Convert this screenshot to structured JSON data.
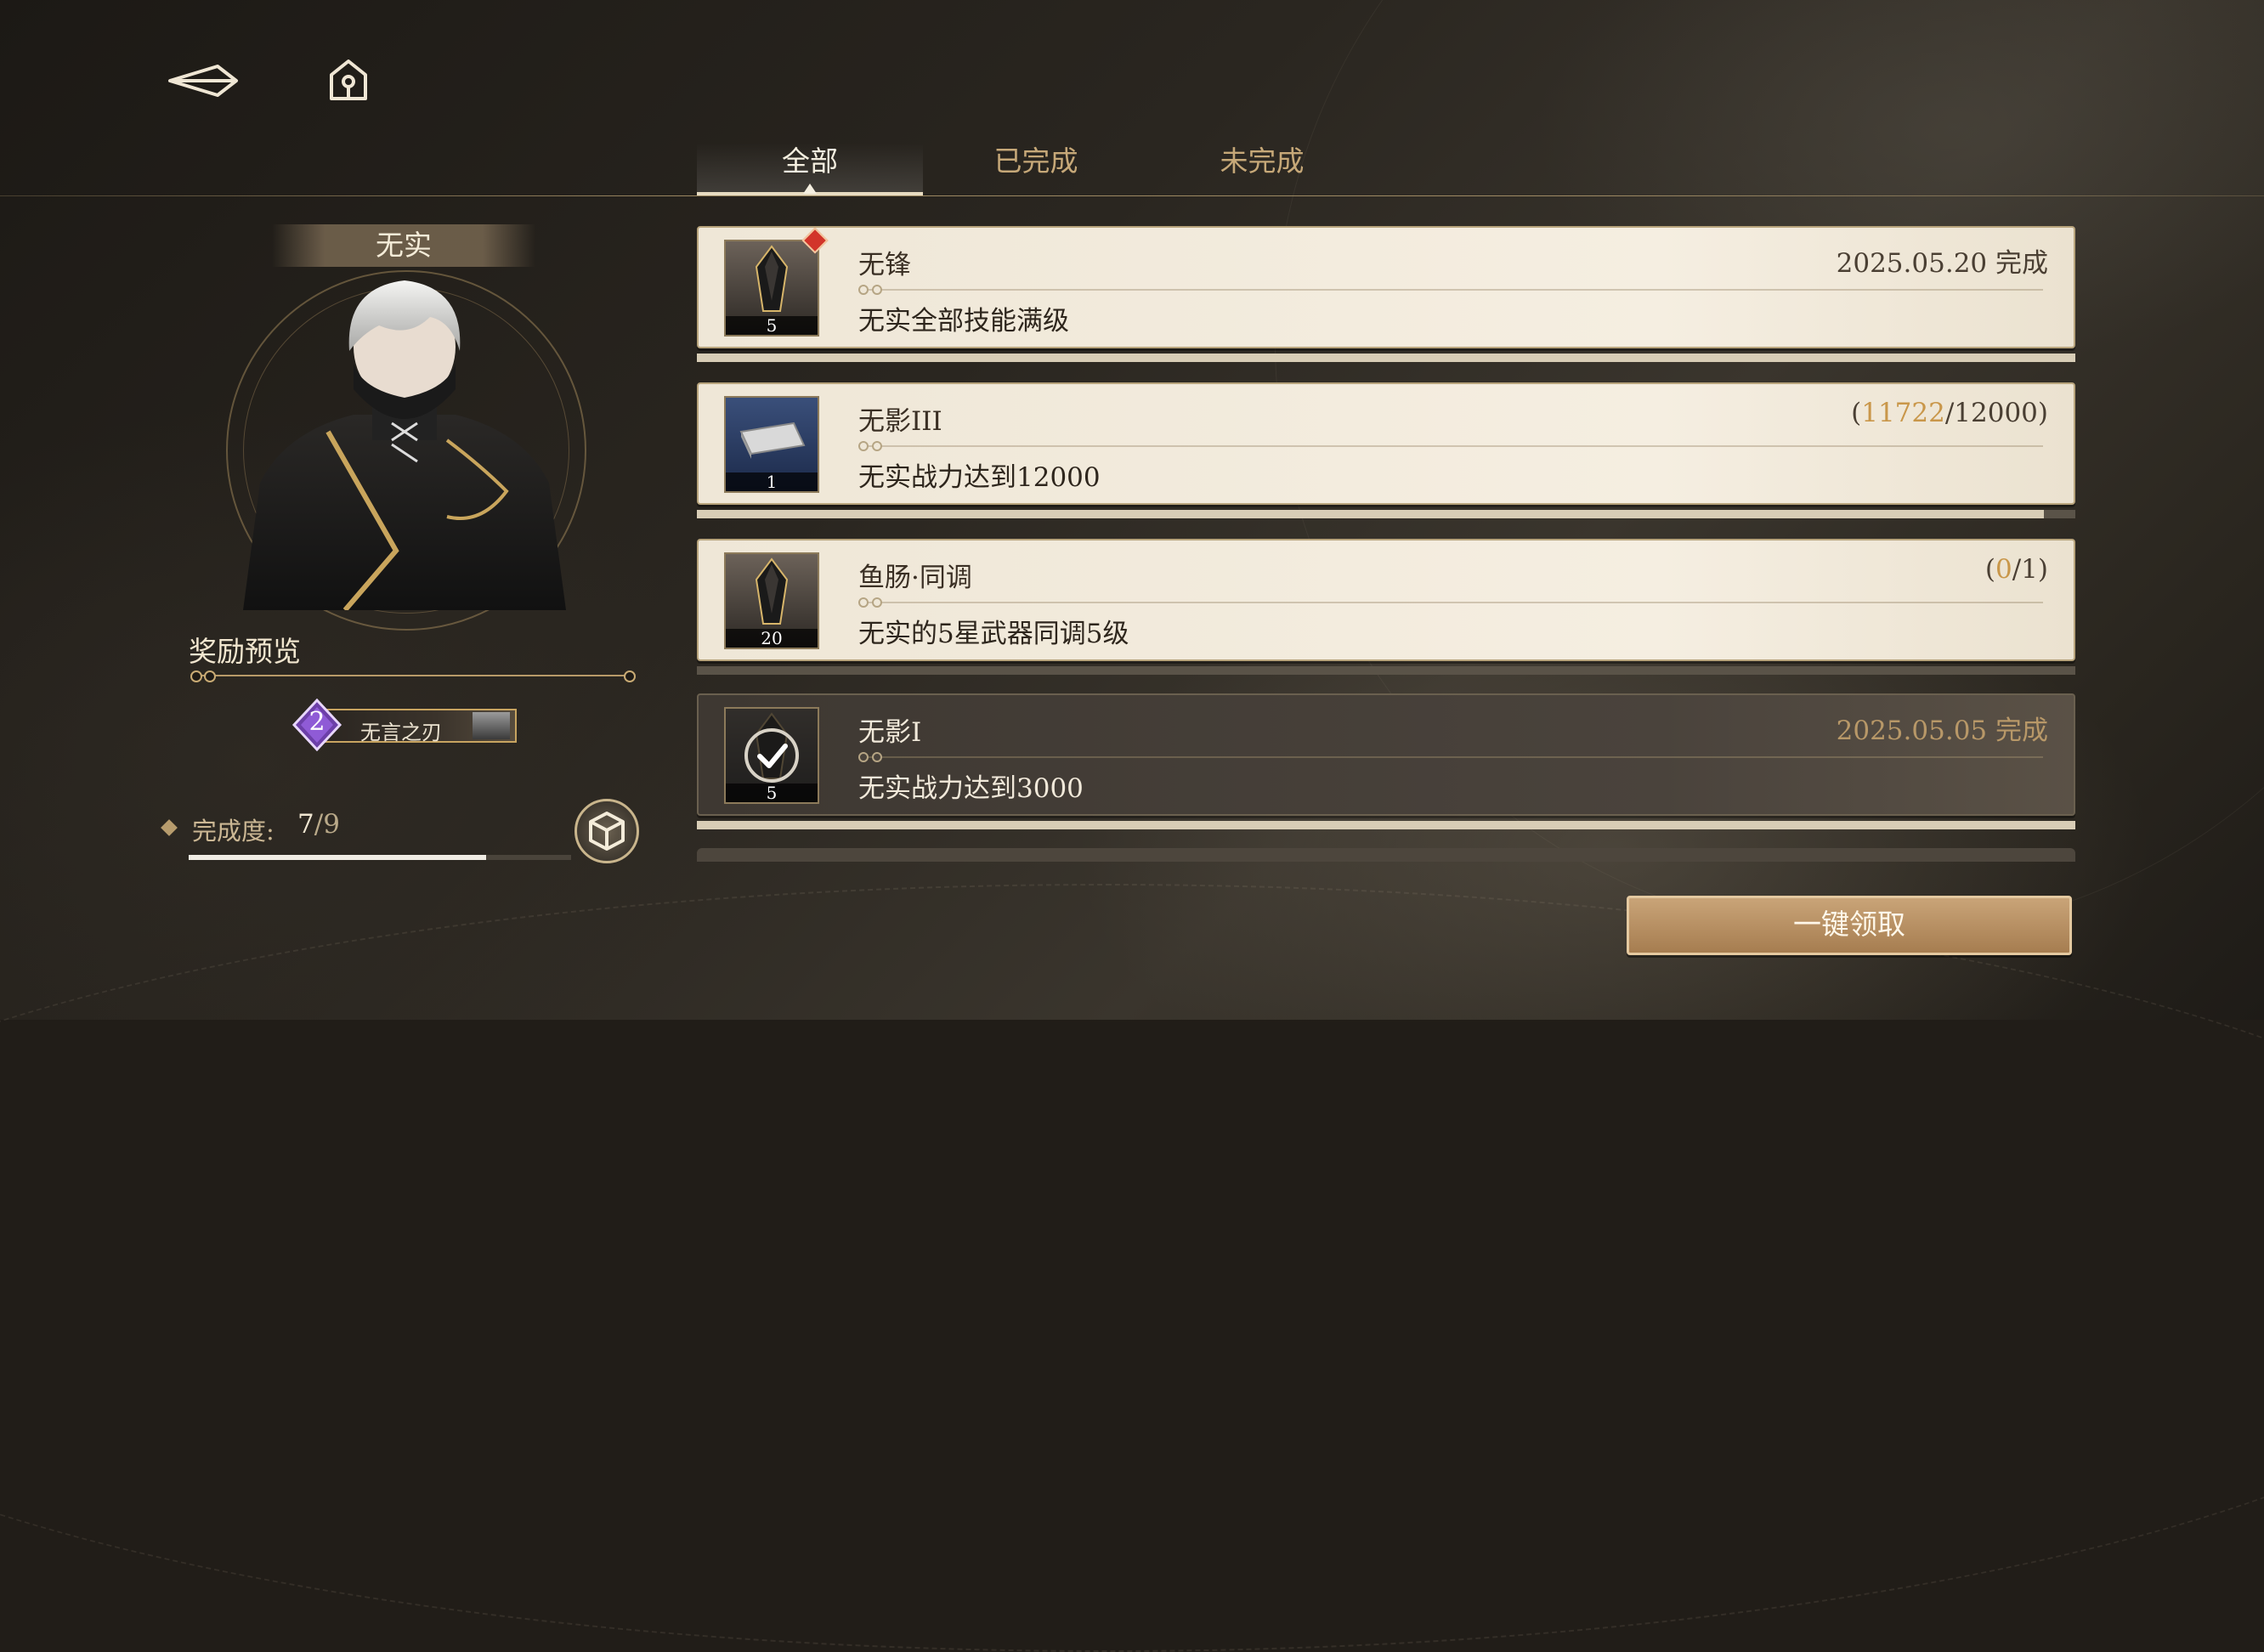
{
  "nav": {
    "back_icon": "back-arrow-icon",
    "home_icon": "home-icon"
  },
  "tabs": [
    {
      "label": "全部",
      "active": true
    },
    {
      "label": "已完成",
      "active": false
    },
    {
      "label": "未完成",
      "active": false
    }
  ],
  "character": {
    "name": "无实"
  },
  "reward": {
    "title": "奖励预览",
    "badge_number": "2",
    "badge_text": "无言之刃"
  },
  "completion": {
    "label": "完成度:",
    "done": "7",
    "separator": "/",
    "total": "9",
    "fraction": 0.7778
  },
  "achievements": [
    {
      "title": "无锋",
      "description": "无实全部技能满级",
      "status": "2025.05.20 完成",
      "count": "5",
      "new": true,
      "completed": false,
      "icon": "black-crystal-icon"
    },
    {
      "title": "无影III",
      "description": "无实战力达到12000",
      "progress_open": "(",
      "progress_current": "11722",
      "progress_rest": "/12000)",
      "progress": 0.977,
      "count": "1",
      "completed": false,
      "icon": "silver-ingot-icon"
    },
    {
      "title": "鱼肠·同调",
      "description": "无实的5星武器同调5级",
      "progress_open": "(",
      "progress_current": "0",
      "progress_rest": "/1)",
      "progress": 0.0,
      "count": "20",
      "completed": false,
      "icon": "black-crystal-icon"
    },
    {
      "title": "无影I",
      "description": "无实战力达到3000",
      "status": "2025.05.05 完成",
      "count": "5",
      "completed": true,
      "icon": "black-crystal-icon"
    }
  ],
  "claim_all": "一键领取",
  "colors": {
    "accent_gold": "#c9974a",
    "card_bg": "#f5eee1",
    "done_card_bg": "#4a433c",
    "new_marker": "#d2352a"
  }
}
